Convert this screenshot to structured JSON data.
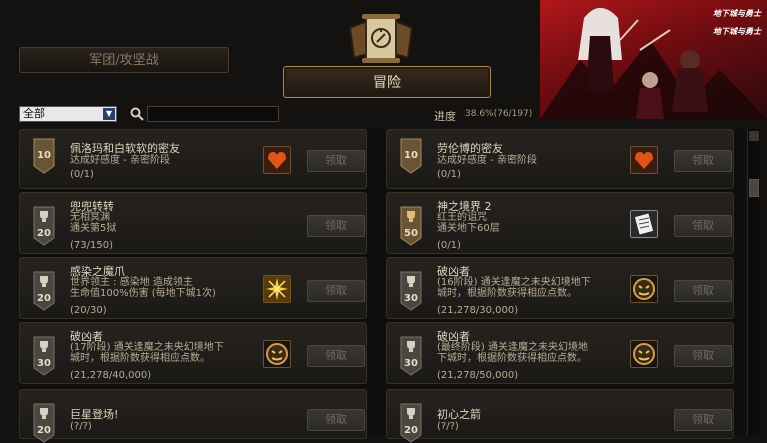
{
  "tabs": {
    "legion": "军团/攻坚战",
    "adventure": "冒险"
  },
  "filter": {
    "selected": "全部",
    "search_placeholder": ""
  },
  "progress": {
    "label": "进度",
    "value": "38.6%(76/197)",
    "percent": 38.6
  },
  "banner": {
    "logo_text": "地下城与勇士"
  },
  "claim_label": "领取",
  "achievements": [
    {
      "level": "10",
      "title": "佩洛玛和白软软的密友",
      "desc": "达成好感度 - 亲密阶段",
      "count": "(0/1)",
      "icon": "heart-gift-icon"
    },
    {
      "level": "10",
      "title": "劳伦博的密友",
      "desc": "达成好感度 - 亲密阶段",
      "count": "(0/1)",
      "icon": "heart-gift-icon"
    },
    {
      "level": "20",
      "title": "兜兜转转",
      "desc": "无相冥渊\n通关第5狱",
      "count": "(73/150)",
      "icon": ""
    },
    {
      "level": "50",
      "title": "神之境界 2",
      "desc": "红王的诅咒\n通关地下60层",
      "count": "(0/1)",
      "icon": "scroll-document-icon"
    },
    {
      "level": "20",
      "title": "感染之魔爪",
      "desc": "世界领主 : 感染地        造成领主\n生命值100%伤害 (每地下城1次)",
      "count": "(20/30)",
      "icon": "golden-burst-icon"
    },
    {
      "level": "30",
      "title": "破凶者",
      "desc": "(16阶段) 通关逢魔之未央幻境地下\n城时，根据阶数获得相应点数。",
      "count": "(21,278/30,000)",
      "icon": "demon-mask-icon"
    },
    {
      "level": "30",
      "title": "破凶者",
      "desc": "(17阶段) 通关逢魔之未央幻境地下\n城时，根据阶数获得相应点数。",
      "count": "(21,278/40,000)",
      "icon": "demon-mask-icon"
    },
    {
      "level": "30",
      "title": "破凶者",
      "desc": "(最终阶段) 通关逢魔之未央幻境地\n下城时，根据阶数获得相应点数。",
      "count": "(21,278/50,000)",
      "icon": "demon-mask-icon"
    },
    {
      "level": "20",
      "title": "巨星登场!",
      "desc": "",
      "count": "(?/?)",
      "icon": ""
    },
    {
      "level": "20",
      "title": "初心之箭",
      "desc": "",
      "count": "(?/?)",
      "icon": ""
    }
  ]
}
